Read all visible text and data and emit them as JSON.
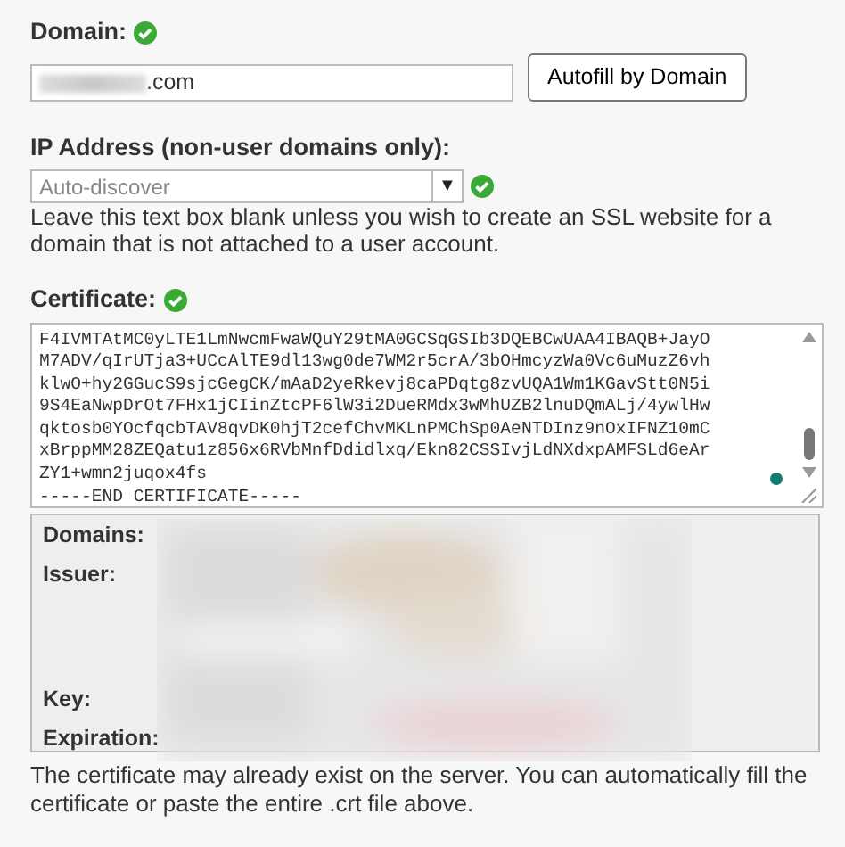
{
  "domain": {
    "label": "Domain:",
    "valid": true,
    "value": ".com",
    "button": "Autofill by Domain"
  },
  "ip_address": {
    "label": "IP Address (non-user domains only):",
    "placeholder": "Auto-discover",
    "valid": true,
    "dropdown_arrow": "▼",
    "help": "Leave this text box blank unless you wish to create an SSL website for a domain that is not attached to a user account."
  },
  "certificate": {
    "label": "Certificate:",
    "valid": true,
    "lines": [
      "F4IVMTAtMC0yLTE1LmNwcmFwaWQuY29tMA0GCSqGSIb3DQEBCwUAA4IBAQB+JayO",
      "M7ADV/qIrUTja3+UCcAlTE9dl13wg0de7WM2r5crA/3bOHmcyzWa0Vc6uMuzZ6vh",
      "klwO+hy2GGucS9sjcGegCK/mAaD2yeRkevj8caPDqtg8zvUQA1Wm1KGavStt0N5i",
      "9S4EaNwpDrOt7FHx1jCIinZtcPF6lW3i2DueRMdx3wMhUZB2lnuDQmALj/4ywlHw",
      "qktosb0YOcfqcbTAV8qvDK0hjT2cefChvMKLnPMChSp0AeNTDInz9nOxIFNZ10mC",
      "xBrppMM28ZEQatu1z856x6RVbMnfDdidlxq/Ekn82CSSIvjLdNXdxpAMFSLd6eAr",
      "ZY1+wmn2juqox4fs",
      "-----END CERTIFICATE-----"
    ],
    "details": [
      {
        "label": "Domains:"
      },
      {
        "label": "Issuer:"
      },
      {
        "label": "Key:"
      },
      {
        "label": "Expiration:"
      }
    ],
    "help": "The certificate may already exist on the server. You can automatically fill the certificate or paste the entire .crt file above."
  }
}
